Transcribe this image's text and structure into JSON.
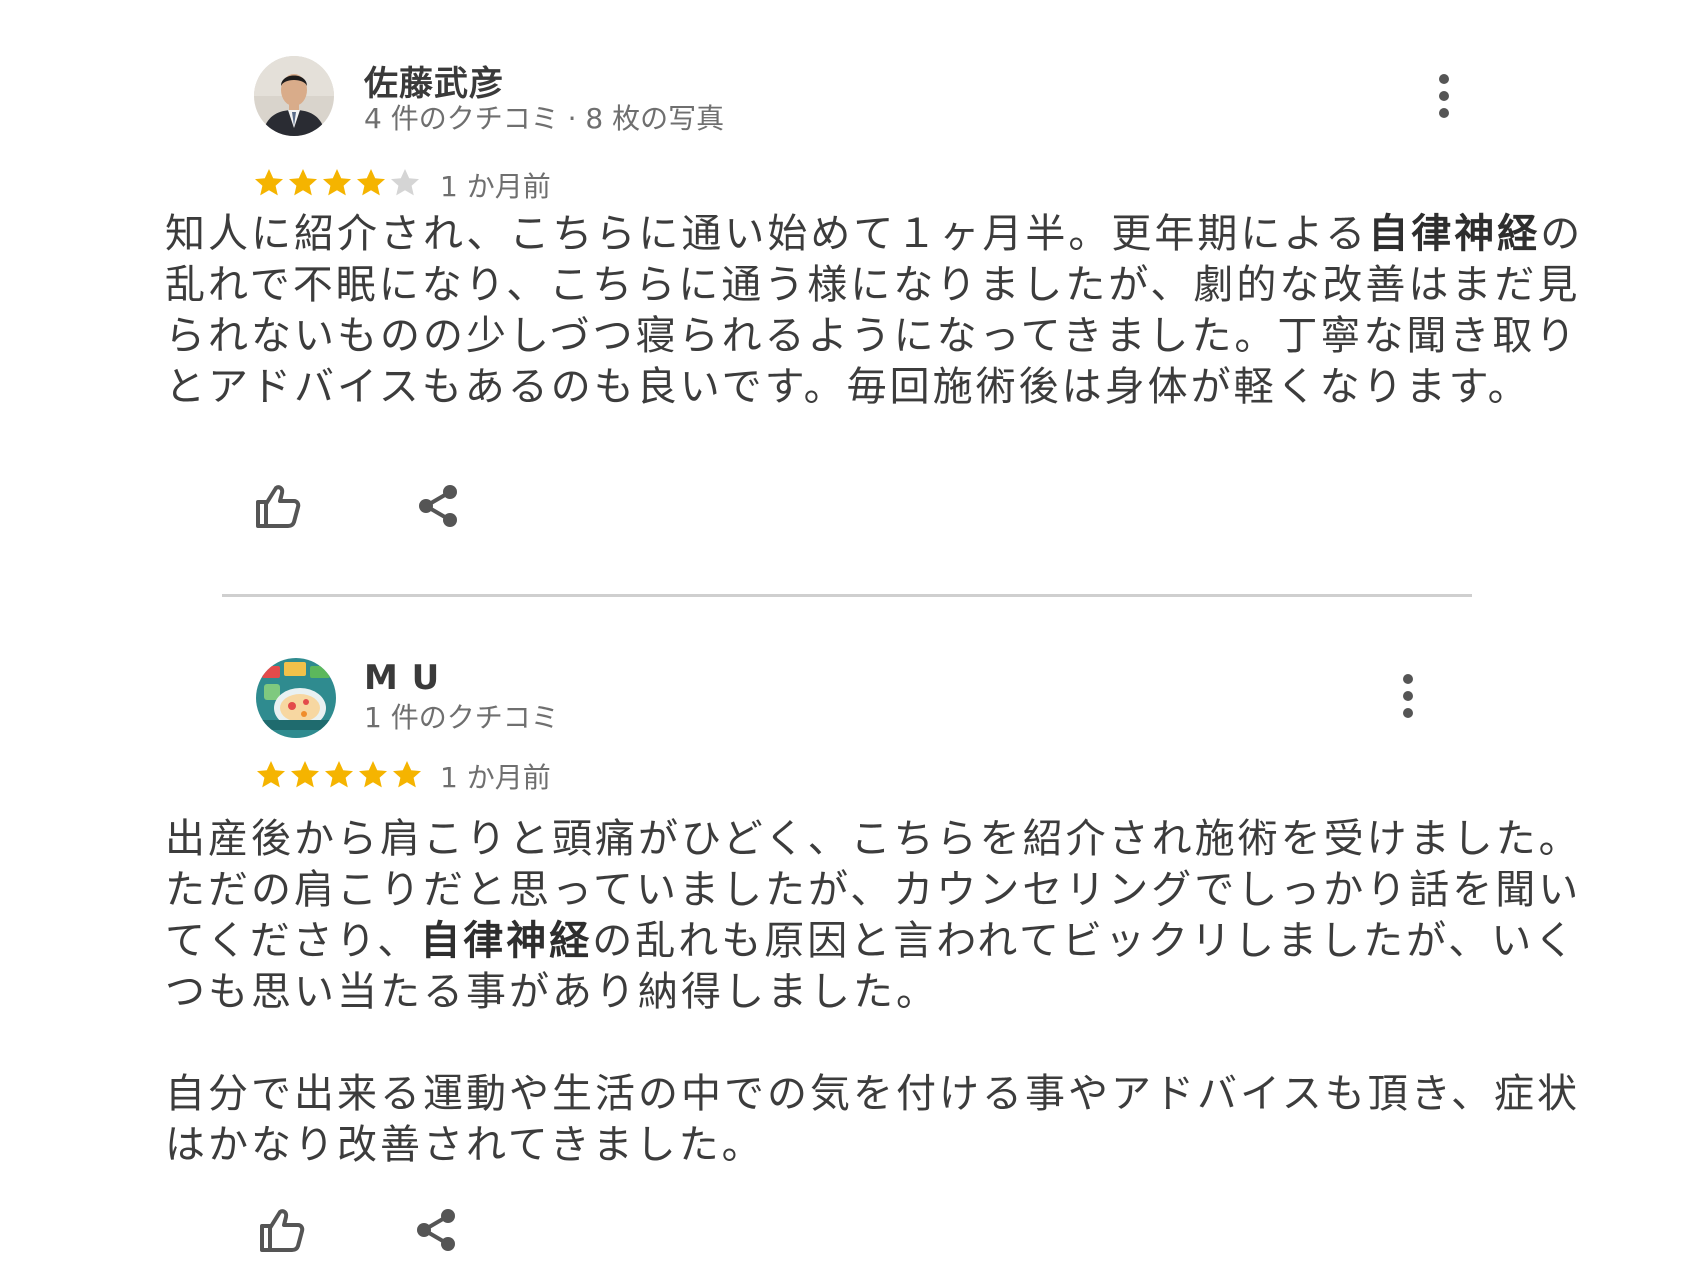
{
  "accent_colors": {
    "star_filled": "#f5b400",
    "star_empty": "#d5d5d5",
    "icon_gray": "#555555",
    "divider": "#cfcfcf"
  },
  "reviews": [
    {
      "reviewer_name": "佐藤武彦",
      "reviewer_meta": "4 件のクチコミ · 8 枚の写真",
      "avatar": "portrait-photo",
      "rating": 4,
      "max_rating": 5,
      "time": "1 か月前",
      "text_parts": [
        "知人に紹介され、こちらに通い始めて１ヶ月半。更年期による",
        "自律神経",
        "の乱れで不眠になり、こちらに通う様になりましたが、劇的な改善はまだ見られないものの少しづつ寝られるようになってきました。丁寧な聞き取りとアドバイスもあるのも良いです。毎回施術後は身体が軽くなります。"
      ],
      "icons": [
        "more-vertical-icon",
        "thumbs-up-icon",
        "share-icon"
      ]
    },
    {
      "reviewer_name": "M U",
      "reviewer_meta": "1 件のクチコミ",
      "avatar": "food-illustration",
      "rating": 5,
      "max_rating": 5,
      "time": "1 か月前",
      "text_parts": [
        "出産後から肩こりと頭痛がひどく、こちらを紹介され施術を受けました。ただの肩こりだと思っていましたが、カウンセリングでしっかり話を聞いてくださり、",
        "自律神経",
        "の乱れも原因と言われてビックリしましたが、いくつも思い当たる事があり納得しました。\n\n自分で出来る運動や生活の中での気を付ける事やアドバイスも頂き、症状はかなり改善されてきました。"
      ],
      "icons": [
        "more-vertical-icon",
        "thumbs-up-icon",
        "share-icon"
      ]
    }
  ]
}
